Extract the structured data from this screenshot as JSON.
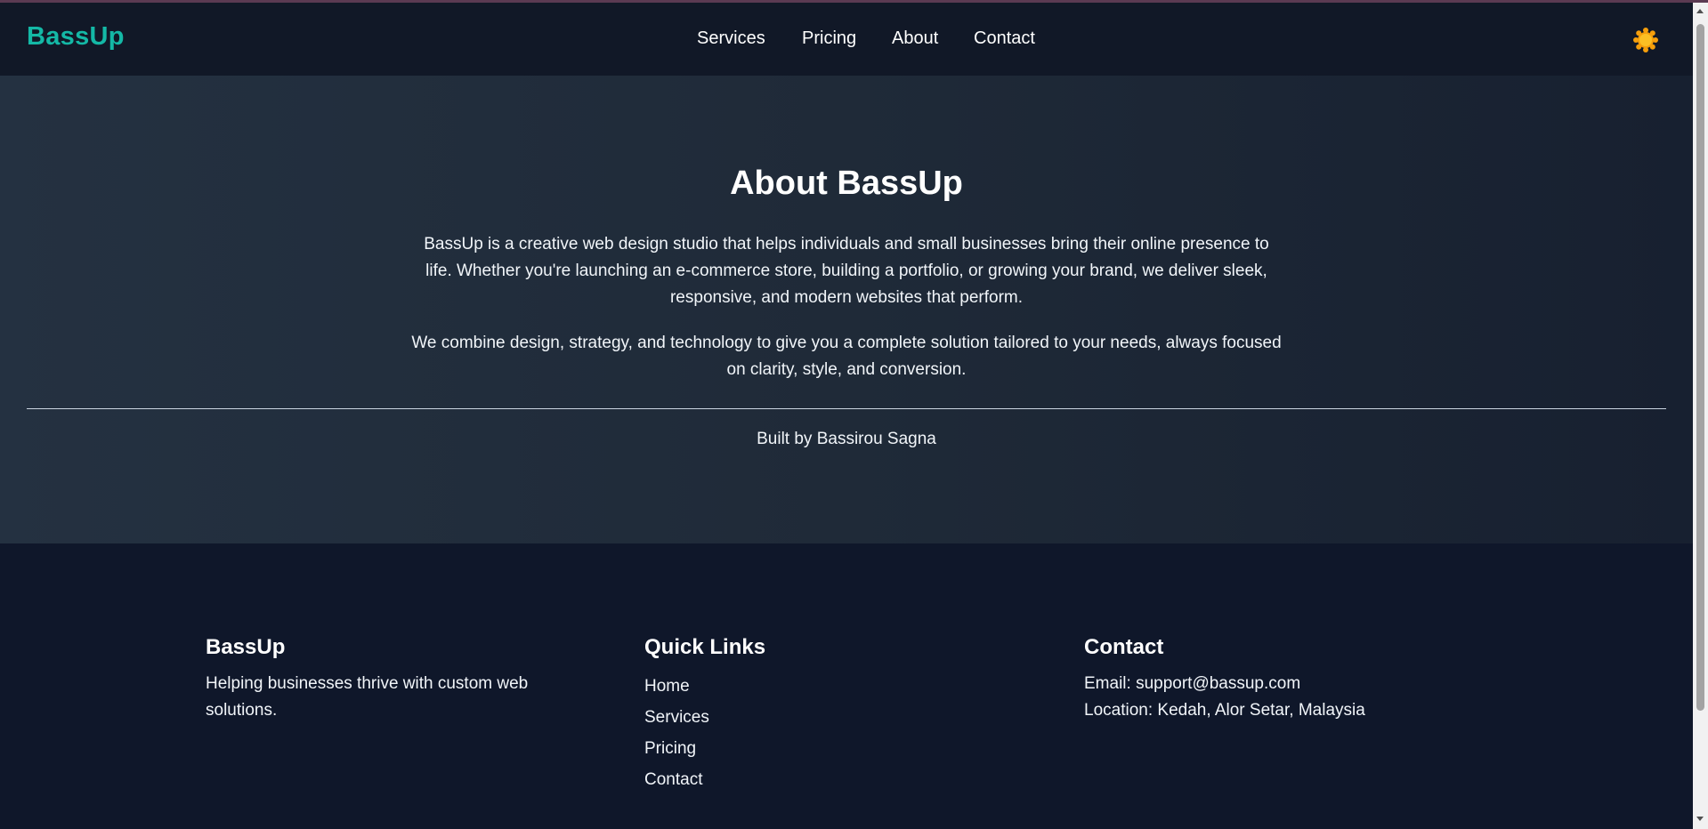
{
  "nav": {
    "brand": "BassUp",
    "links": [
      "Services",
      "Pricing",
      "About",
      "Contact"
    ],
    "theme_icon": "sun-icon"
  },
  "about": {
    "title": "About BassUp",
    "paragraph_1": "BassUp is a creative web design studio that helps individuals and small businesses bring their online presence to life. Whether you're launching an e-commerce store, building a portfolio, or growing your brand, we deliver sleek, responsive, and modern websites that perform.",
    "paragraph_2": "We combine design, strategy, and technology to give you a complete solution tailored to your needs, always focused on clarity, style, and conversion.",
    "built_by": "Built by Bassirou Sagna"
  },
  "footer": {
    "brand": {
      "heading": "BassUp",
      "text": "Helping businesses thrive with custom web solutions."
    },
    "quick_links": {
      "heading": "Quick Links",
      "items": [
        "Home",
        "Services",
        "Pricing",
        "Contact"
      ]
    },
    "contact": {
      "heading": "Contact",
      "email": "Email: support@bassup.com",
      "location": "Location: Kedah, Alor Setar, Malaysia"
    }
  },
  "colors": {
    "accent": "#14b8a6",
    "nav_bg": "#111827",
    "page_bg": "#0f172a",
    "sun": "#f59e0b"
  }
}
